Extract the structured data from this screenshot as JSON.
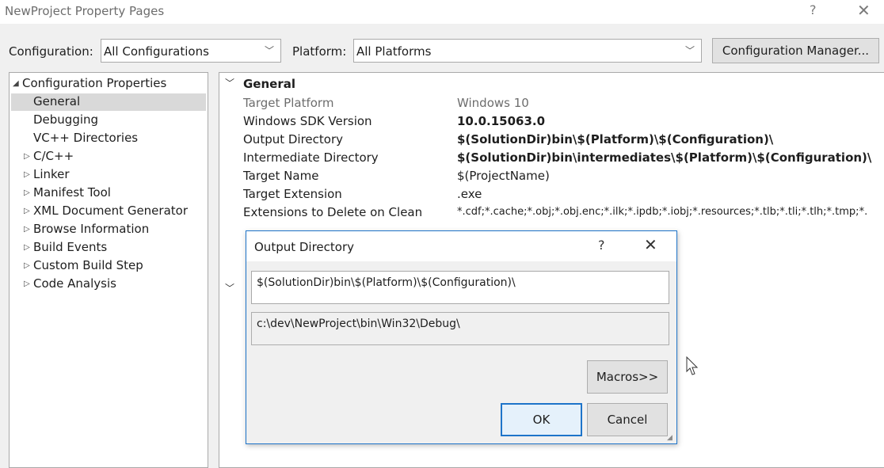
{
  "window": {
    "title": "NewProject Property Pages",
    "help_glyph": "?",
    "close_glyph": "✕"
  },
  "toolbar": {
    "configuration_label": "Configuration:",
    "configuration_value": "All Configurations",
    "platform_label": "Platform:",
    "platform_value": "All Platforms",
    "config_manager_label": "Configuration Manager..."
  },
  "tree": {
    "root": "Configuration Properties",
    "items": [
      {
        "label": "General",
        "expandable": false,
        "selected": true
      },
      {
        "label": "Debugging",
        "expandable": false
      },
      {
        "label": "VC++ Directories",
        "expandable": false
      },
      {
        "label": "C/C++",
        "expandable": true
      },
      {
        "label": "Linker",
        "expandable": true
      },
      {
        "label": "Manifest Tool",
        "expandable": true
      },
      {
        "label": "XML Document Generator",
        "expandable": true
      },
      {
        "label": "Browse Information",
        "expandable": true
      },
      {
        "label": "Build Events",
        "expandable": true
      },
      {
        "label": "Custom Build Step",
        "expandable": true
      },
      {
        "label": "Code Analysis",
        "expandable": true
      }
    ]
  },
  "grid": {
    "section": "General",
    "rows": [
      {
        "name": "Target Platform",
        "value": "Windows 10",
        "muted": true,
        "bold": false
      },
      {
        "name": "Windows SDK Version",
        "value": "10.0.15063.0",
        "muted": false,
        "bold": true
      },
      {
        "name": "Output Directory",
        "value": "$(SolutionDir)bin\\$(Platform)\\$(Configuration)\\",
        "muted": false,
        "bold": true
      },
      {
        "name": "Intermediate Directory",
        "value": "$(SolutionDir)bin\\intermediates\\$(Platform)\\$(Configuration)\\",
        "muted": false,
        "bold": true
      },
      {
        "name": "Target Name",
        "value": "$(ProjectName)",
        "muted": false,
        "bold": false
      },
      {
        "name": "Target Extension",
        "value": ".exe",
        "muted": false,
        "bold": false
      },
      {
        "name": "Extensions to Delete on Clean",
        "value": "*.cdf;*.cache;*.obj;*.obj.enc;*.ilk;*.ipdb;*.iobj;*.resources;*.tlb;*.tli;*.tlh;*.tmp;*.",
        "muted": false,
        "bold": false
      }
    ]
  },
  "dialog": {
    "title": "Output Directory",
    "help_glyph": "?",
    "close_glyph": "✕",
    "edit_value": "$(SolutionDir)bin\\$(Platform)\\$(Configuration)\\",
    "evaluated_value": "c:\\dev\\NewProject\\bin\\Win32\\Debug\\",
    "macros_label": "Macros>>",
    "ok_label": "OK",
    "cancel_label": "Cancel"
  }
}
